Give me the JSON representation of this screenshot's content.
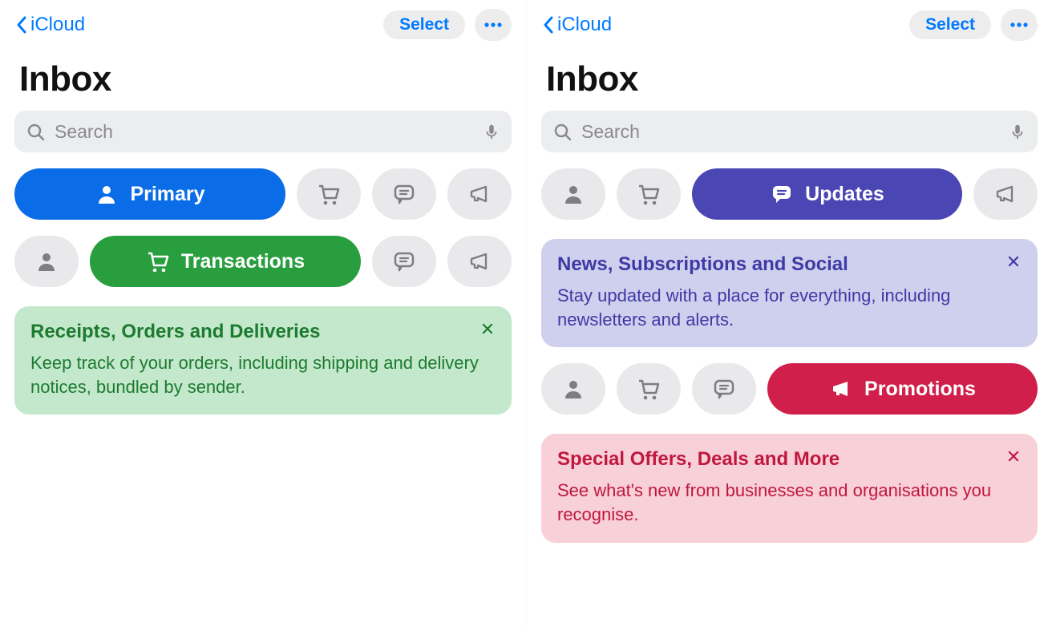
{
  "colors": {
    "ios_blue": "#007aff",
    "primary": "#0a6de7",
    "transactions": "#299e3e",
    "updates": "#4a47b4",
    "promotions": "#d11f4b"
  },
  "panes": [
    {
      "back_label": "iCloud",
      "select_label": "Select",
      "title": "Inbox",
      "search": {
        "placeholder": "Search",
        "value": ""
      },
      "rows": [
        {
          "active_key": "primary",
          "chips": {
            "primary": {
              "label": "Primary",
              "icon": "person-icon"
            },
            "trans": {
              "icon": "cart-icon"
            },
            "updates": {
              "icon": "chat-icon"
            },
            "promos": {
              "icon": "megaphone-icon"
            }
          }
        },
        {
          "active_key": "trans",
          "chips": {
            "primary": {
              "icon": "person-icon"
            },
            "trans": {
              "label": "Transactions",
              "icon": "cart-icon"
            },
            "updates": {
              "icon": "chat-icon"
            },
            "promos": {
              "icon": "megaphone-icon"
            }
          }
        }
      ],
      "banner": {
        "variant": "green",
        "title": "Receipts, Orders and Deliveries",
        "body": "Keep track of your orders, including shipping and delivery notices, bundled by sender."
      }
    },
    {
      "back_label": "iCloud",
      "select_label": "Select",
      "title": "Inbox",
      "search": {
        "placeholder": "Search",
        "value": ""
      },
      "rows": [
        {
          "active_key": "updates",
          "chips": {
            "primary": {
              "icon": "person-icon"
            },
            "trans": {
              "icon": "cart-icon"
            },
            "updates": {
              "label": "Updates",
              "icon": "chat-icon"
            },
            "promos": {
              "icon": "megaphone-icon"
            }
          }
        }
      ],
      "banner_updates": {
        "variant": "purple",
        "title": "News, Subscriptions and Social",
        "body": "Stay updated with a place for everything, including newsletters and alerts."
      },
      "rows2": [
        {
          "active_key": "promos",
          "chips": {
            "primary": {
              "icon": "person-icon"
            },
            "trans": {
              "icon": "cart-icon"
            },
            "updates": {
              "icon": "chat-icon"
            },
            "promos": {
              "label": "Promotions",
              "icon": "megaphone-icon"
            }
          }
        }
      ],
      "banner_promos": {
        "variant": "pink",
        "title": "Special Offers, Deals and More",
        "body": "See what's new from businesses and organisations you recognise."
      }
    }
  ]
}
